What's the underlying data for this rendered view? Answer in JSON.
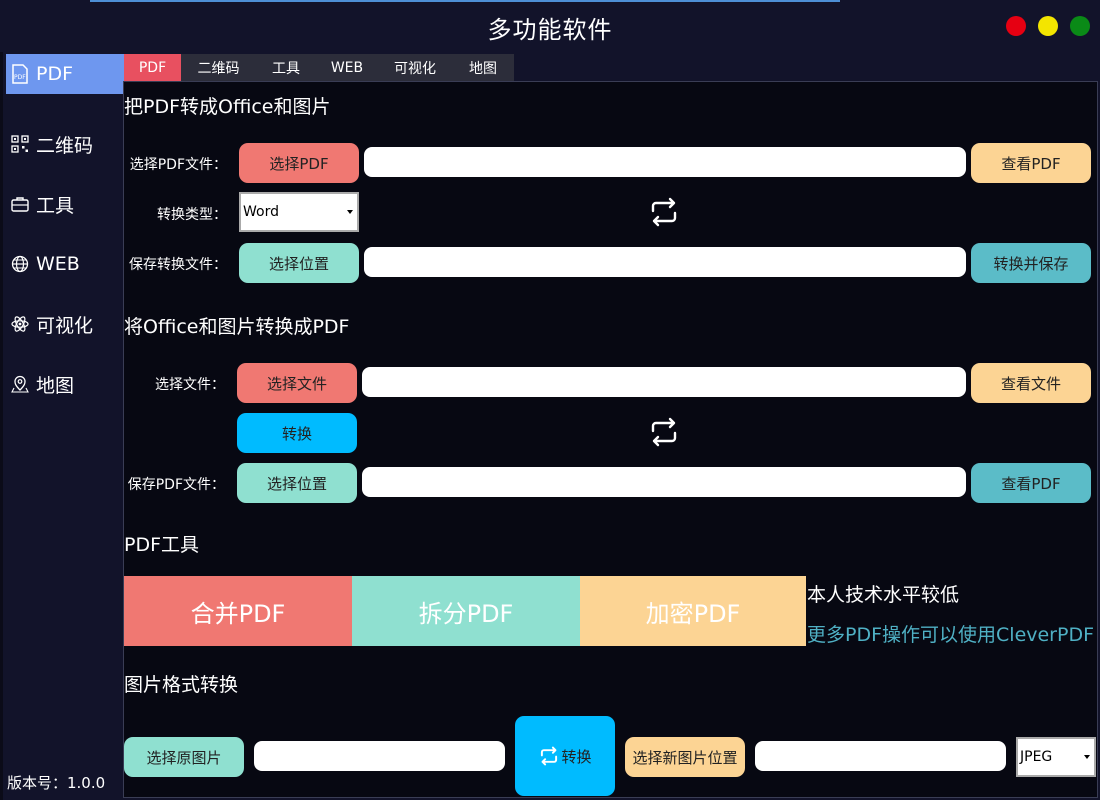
{
  "window": {
    "title": "多功能软件"
  },
  "sidebar": {
    "items": [
      {
        "label": "PDF",
        "icon": "pdf-file-icon"
      },
      {
        "label": "二维码",
        "icon": "qr-code-icon"
      },
      {
        "label": "工具",
        "icon": "toolbox-icon"
      },
      {
        "label": "WEB",
        "icon": "globe-icon"
      },
      {
        "label": "可视化",
        "icon": "atom-icon"
      },
      {
        "label": "地图",
        "icon": "map-pin-icon"
      }
    ],
    "version": "版本号：1.0.0"
  },
  "tabs": [
    "PDF",
    "二维码",
    "工具",
    "WEB",
    "可视化",
    "地图"
  ],
  "pdf_to_office": {
    "title": "把PDF转成Office和图片",
    "choose_label": "选择PDF文件：",
    "choose_button": "选择PDF",
    "choose_value": "",
    "view_button": "查看PDF",
    "type_label": "转换类型：",
    "type_selected": "Word",
    "save_label": "保存转换文件：",
    "save_button": "选择位置",
    "save_value": "",
    "convert_save_button": "转换并保存"
  },
  "office_to_pdf": {
    "title": "将Office和图片转换成PDF",
    "choose_label": "选择文件：",
    "choose_button": "选择文件",
    "choose_value": "",
    "view_button": "查看文件",
    "convert_button": "转换",
    "save_label": "保存PDF文件：",
    "save_button": "选择位置",
    "save_value": "",
    "view_pdf_button": "查看PDF"
  },
  "pdf_tools": {
    "title": "PDF工具",
    "merge": "合并PDF",
    "split": "拆分PDF",
    "encrypt": "加密PDF",
    "note": "本人技术水平较低",
    "link": "更多PDF操作可以使用CleverPDF"
  },
  "image_convert": {
    "title": "图片格式转换",
    "choose_button": "选择原图片",
    "choose_value": "",
    "convert_button": "转换",
    "new_location_button": "选择新图片位置",
    "new_location_value": "",
    "format_selected": "JPEG"
  },
  "colors": {
    "accent_red": "#f07872",
    "mint": "#8fe0d0",
    "peach": "#fcd494",
    "teal": "#5bbcc8",
    "cyan": "#00bbff",
    "sidebar_active": "#6e97ef",
    "tab_active": "#e85060",
    "link": "#4fb0c4"
  }
}
